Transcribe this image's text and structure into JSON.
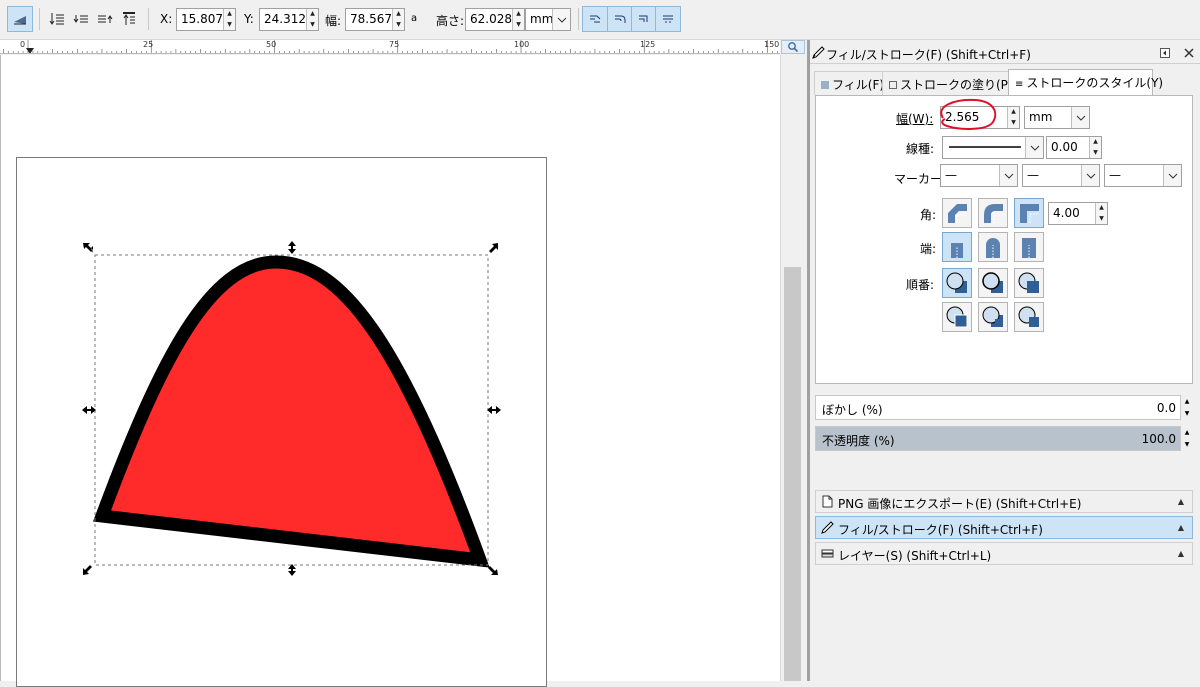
{
  "toolbar": {
    "x_label": "X:",
    "x_value": "15.807",
    "y_label": "Y:",
    "y_value": "24.312",
    "w_label": "幅:",
    "w_value": "78.567",
    "lock_symbol": "a",
    "h_label": "高さ:",
    "h_value": "62.028",
    "unit": "mm",
    "icons": [
      "select-all-icon",
      "raise-to-top-icon",
      "raise-icon",
      "lower-icon",
      "lower-to-bottom-icon",
      "scale-stroke-icon",
      "scale-corners-icon",
      "transform-gradients-icon",
      "transform-patterns-icon"
    ]
  },
  "ruler": {
    "labels": [
      "0",
      "25",
      "50",
      "75",
      "100",
      "125",
      "150"
    ]
  },
  "panel": {
    "title": "フィル/ストローク(F) (Shift+Ctrl+F)",
    "tabs": [
      {
        "label": "フィル(F)"
      },
      {
        "label": "ストロークの塗り(P)"
      },
      {
        "label": "ストロークのスタイル(Y)"
      }
    ],
    "width_label": "幅(W):",
    "width_value": "2.565",
    "width_unit": "mm",
    "dash_label": "線種:",
    "dash_offset": "0.00",
    "marker_label": "マーカー:",
    "marker_start": "—",
    "marker_mid": "—",
    "marker_end": "—",
    "join_label": "角:",
    "miter_limit": "4.00",
    "cap_label": "端:",
    "order_label": "順番:",
    "blur_label": "ぼかし (%)",
    "blur_value": "0.0",
    "opacity_label": "不透明度 (%)",
    "opacity_value": "100.0"
  },
  "docks": [
    {
      "label": "PNG 画像にエクスポート(E) (Shift+Ctrl+E)",
      "active": false
    },
    {
      "label": "フィル/ストローク(F) (Shift+Ctrl+F)",
      "active": true
    },
    {
      "label": "レイヤー(S) (Shift+Ctrl+L)",
      "active": false
    }
  ],
  "colors": {
    "shape_fill": "#ff2a2a",
    "shape_stroke": "#000000",
    "annotation": "#e0102a",
    "selection_accent": "#cde4f7"
  }
}
